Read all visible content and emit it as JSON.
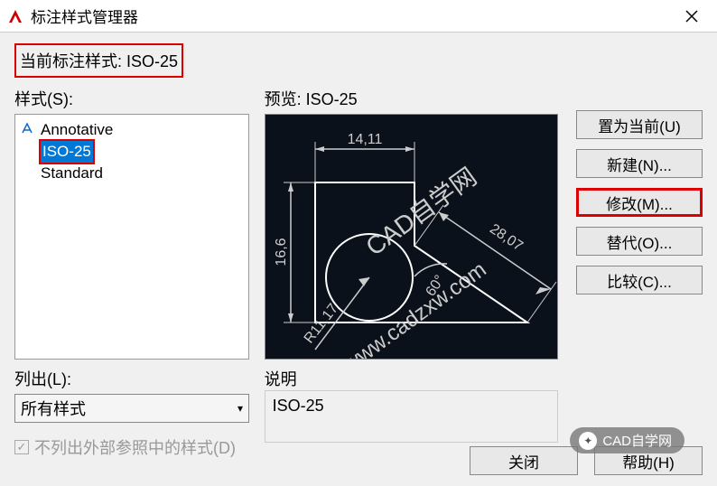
{
  "titlebar": {
    "title": "标注样式管理器"
  },
  "current_style_label": "当前标注样式: ISO-25",
  "styles_label": "样式(S):",
  "styles": {
    "items": [
      {
        "label": "Annotative",
        "icon": "annotative"
      },
      {
        "label": "ISO-25",
        "selected": true
      },
      {
        "label": "Standard"
      }
    ]
  },
  "list_out_label": "列出(L):",
  "list_out_value": "所有样式",
  "checkbox_label": "不列出外部参照中的样式(D)",
  "checkbox_checked": true,
  "preview_label": "预览: ISO-25",
  "preview": {
    "dim_top": "14,11",
    "dim_left": "16,6",
    "dim_radius": "R11,17",
    "dim_angle": "60°",
    "dim_diag": "28,07",
    "watermark_text1": "CAD自学网",
    "watermark_text2": "www.cadzxw.com"
  },
  "desc_label": "说明",
  "desc_value": "ISO-25",
  "buttons": {
    "set_current": "置为当前(U)",
    "new": "新建(N)...",
    "modify": "修改(M)...",
    "override": "替代(O)...",
    "compare": "比较(C)..."
  },
  "bottom": {
    "close": "关闭",
    "help": "帮助(H)"
  },
  "watermark": "CAD自学网"
}
